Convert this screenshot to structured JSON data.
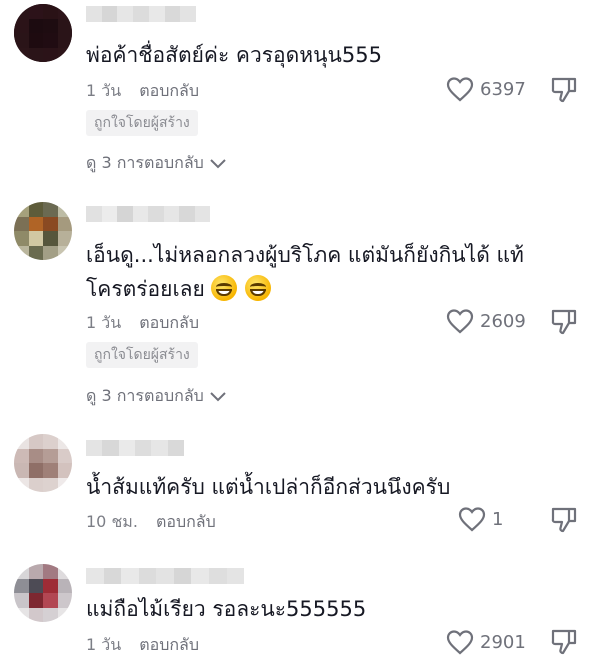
{
  "comments": [
    {
      "text": "พ่อค้าชื่อสัตย์ค่ะ ควรอุดหนุน555",
      "time": "1 วัน",
      "reply": "ตอบกลับ",
      "likes": "6397",
      "badge": "ถูกใจโดยผู้สร้าง",
      "view_replies": "ดู 3 การตอบกลับ"
    },
    {
      "text_line1": "เอ็นดู...ไม่หลอกลวงผู้บริโภค แต่มันก็ยังกินได้ แท้",
      "text_line2": "โครตร่อยเลย",
      "time": "1 วัน",
      "reply": "ตอบกลับ",
      "likes": "2609",
      "badge": "ถูกใจโดยผู้สร้าง",
      "view_replies": "ดู 3 การตอบกลับ"
    },
    {
      "text": "น้ำส้มแท้ครับ แต่น้ำเปล่าก็อีกส่วนนึงครับ",
      "time": "10 ชม.",
      "reply": "ตอบกลับ",
      "likes": "1"
    },
    {
      "text": "แม่ถือไม้เรียว รอละนะ555555",
      "time": "1 วัน",
      "reply": "ตอบกลับ",
      "likes": "2901"
    }
  ],
  "icons": {
    "like": "heart-outline-icon",
    "dislike": "thumbs-down-outline-icon",
    "expand": "chevron-down-icon",
    "emoji": "grinning-face-emoji"
  },
  "colors": {
    "text": "#161823",
    "meta": "#7c7e86",
    "badge_bg": "#f2f2f3"
  }
}
